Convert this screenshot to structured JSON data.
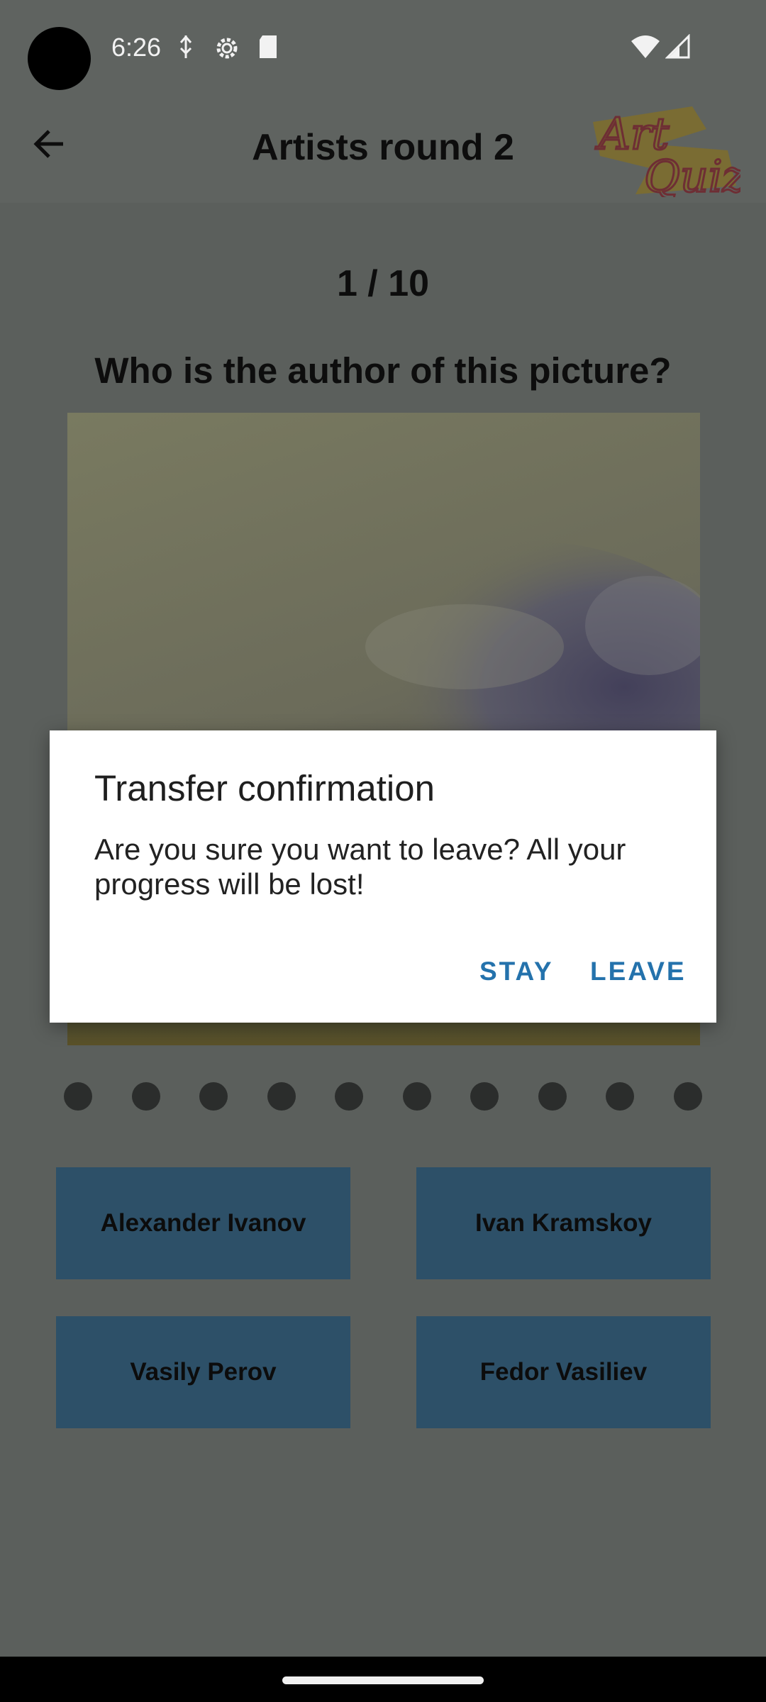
{
  "status_bar": {
    "time": "6:26",
    "icons": [
      "usb-debug-icon",
      "settings-gear-icon",
      "sd-card-icon",
      "wifi-icon",
      "cell-signal-icon"
    ]
  },
  "app_bar": {
    "title": "Artists round 2",
    "logo_text": [
      "Art",
      "Quiz"
    ]
  },
  "quiz": {
    "progress": "1 / 10",
    "question": "Who is the author of this picture?",
    "progress_dots": 10,
    "answers": [
      {
        "label": "Alexander Ivanov"
      },
      {
        "label": "Ivan Kramskoy"
      },
      {
        "label": "Vasily Perov"
      },
      {
        "label": "Fedor Vasiliev"
      }
    ]
  },
  "dialog": {
    "title": "Transfer confirmation",
    "message": "Are you sure you want to leave? All your progress will be lost!",
    "stay_label": "STAY",
    "leave_label": "LEAVE"
  },
  "colors": {
    "scrim_background": "#5f6360",
    "answer_button": "#2d5068",
    "dialog_accent": "#2472ac",
    "dialog_background": "#ffffff"
  }
}
